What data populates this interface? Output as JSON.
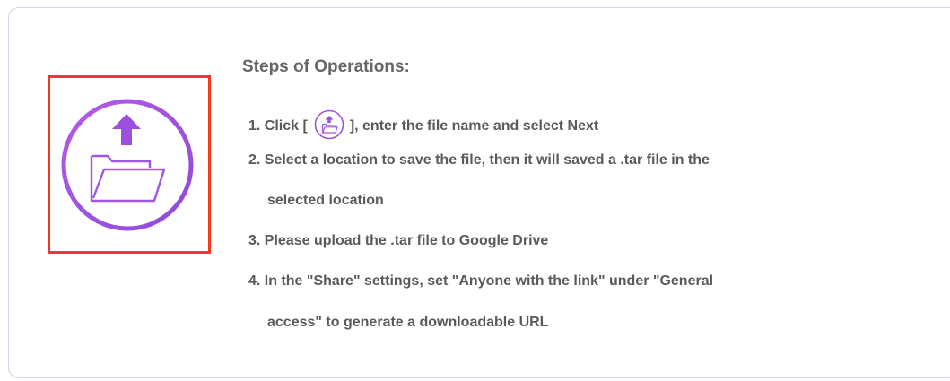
{
  "header": {
    "title": "Steps of Operations:"
  },
  "export_button": {
    "icon": "folder-upload-icon",
    "accent_color": "#a153e0",
    "highlight_color": "#f0391f"
  },
  "steps": {
    "step1": {
      "prefix": "1. Click [",
      "icon": "folder-upload-icon",
      "suffix": "], enter the file name and select Next"
    },
    "step2": {
      "line1": "2. Select a location to save the file, then it will saved a .tar file in the",
      "line2": "selected location"
    },
    "step3": {
      "line1": "3. Please upload the .tar file to Google Drive"
    },
    "step4": {
      "line1": "4. In the \"Share\" settings, set \"Anyone with the link\" under \"General",
      "line2": "access\" to generate a downloadable URL"
    }
  }
}
